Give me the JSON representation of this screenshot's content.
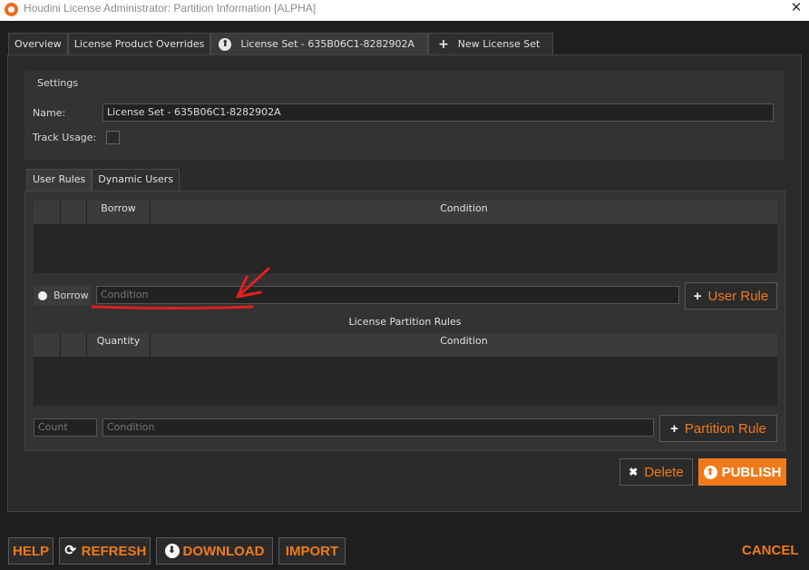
{
  "window": {
    "title": "Houdini License Administrator: Partition Information [ALPHA]",
    "close_label": "✕"
  },
  "tabs": [
    {
      "label": "Overview"
    },
    {
      "label": "License Product Overrides"
    },
    {
      "label": "License Set - 635B06C1-8282902A",
      "icon": "upload-icon"
    },
    {
      "label": "New License Set",
      "icon": "plus-icon"
    }
  ],
  "settings": {
    "title": "Settings",
    "name_label": "Name:",
    "name_value": "License Set - 635B06C1-8282902A",
    "track_usage_label": "Track Usage:"
  },
  "subtabs": [
    {
      "label": "User Rules"
    },
    {
      "label": "Dynamic Users"
    }
  ],
  "user_rules": {
    "columns": [
      "",
      "",
      "Borrow",
      "Condition"
    ],
    "borrow_label": "Borrow",
    "condition_placeholder": "Condition",
    "add_button": "User Rule"
  },
  "partition_rules": {
    "title": "License Partition Rules",
    "columns": [
      "",
      "",
      "Quantity",
      "Condition"
    ],
    "count_placeholder": "Count",
    "condition_placeholder": "Condition",
    "add_button": "Partition Rule"
  },
  "actions": {
    "delete": "Delete",
    "publish": "PUBLISH"
  },
  "footer": {
    "help": "HELP",
    "refresh": "REFRESH",
    "download": "DOWNLOAD",
    "import": "IMPORT",
    "cancel": "CANCEL"
  },
  "colors": {
    "accent": "#f07a1a",
    "annotation": "#e02020"
  }
}
